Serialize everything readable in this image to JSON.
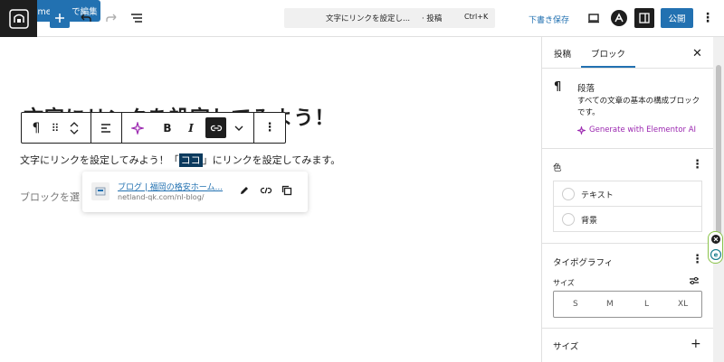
{
  "topbar": {
    "elementor_label": "Elementor で編集",
    "command_title": "文字にリンクを設定し...",
    "command_type": "· 投稿",
    "command_shortcut": "Ctrl+K",
    "draft_save_label": "下書き保存",
    "publish_label": "公開"
  },
  "editor": {
    "post_title": "文字にリンクを設定してみよう！",
    "para_before": "文字にリンクを設定してみよう！「",
    "para_selected": "ココ",
    "para_after": "」にリンクを設定してみます。",
    "placeholder": "ブロックを選",
    "toolbar": {
      "paragraph_icon": "¶",
      "bold": "B",
      "italic": "I"
    },
    "link_popover": {
      "title": "ブログ | 福岡の格安ホーム...",
      "url": "netland-qk.com/nl-blog/"
    }
  },
  "sidebar": {
    "tabs": [
      "投稿",
      "ブロック"
    ],
    "active_tab": "ブロック",
    "block_name": "段落",
    "block_description": "すべての文章の基本の構成ブロックです。",
    "ai_label": "Generate with Elementor AI",
    "color_heading": "色",
    "color_items": [
      "テキスト",
      "背景"
    ],
    "typography_heading": "タイポグラフィ",
    "size_label": "サイズ",
    "size_options": [
      "S",
      "M",
      "L",
      "XL"
    ],
    "size_panel_heading": "サイズ"
  },
  "colors": {
    "accent": "#2271b1",
    "dark": "#1e1e1e",
    "selection": "#0b3a5e",
    "ai": "#9b27b0"
  }
}
